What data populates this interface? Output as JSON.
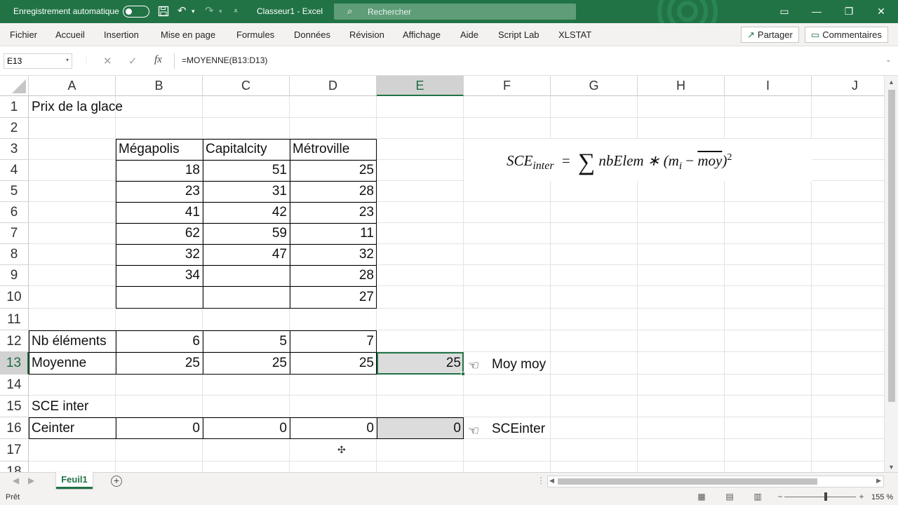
{
  "titlebar": {
    "autosave_label": "Enregistrement automatique",
    "doc_title": "Classeur1  -  Excel",
    "search_placeholder": "Rechercher",
    "accent": "#217346"
  },
  "ribbon": {
    "tabs": [
      "Fichier",
      "Accueil",
      "Insertion",
      "Mise en page",
      "Formules",
      "Données",
      "Révision",
      "Affichage",
      "Aide",
      "Script Lab",
      "XLSTAT"
    ],
    "share_label": "Partager",
    "comments_label": "Commentaires"
  },
  "formula_bar": {
    "name_box": "E13",
    "formula": "=MOYENNE(B13:D13)"
  },
  "columns": [
    "A",
    "B",
    "C",
    "D",
    "E",
    "F",
    "G",
    "H",
    "I",
    "J"
  ],
  "selected_column": "E",
  "rows": [
    "1",
    "2",
    "3",
    "4",
    "5",
    "6",
    "7",
    "8",
    "9",
    "10",
    "11",
    "12",
    "13",
    "14",
    "15",
    "16",
    "17",
    "18"
  ],
  "selected_row": "13",
  "cells": {
    "A1": "Prix de la glace",
    "B3": "Mégapolis",
    "C3": "Capitalcity",
    "D3": "Métroville",
    "B4": "18",
    "C4": "51",
    "D4": "25",
    "B5": "23",
    "C5": "31",
    "D5": "28",
    "B6": "41",
    "C6": "42",
    "D6": "23",
    "B7": "62",
    "C7": "59",
    "D7": "11",
    "B8": "32",
    "C8": "47",
    "D8": "32",
    "B9": "34",
    "D9": "28",
    "D10": "27",
    "A12": "Nb éléments",
    "B12": "6",
    "C12": "5",
    "D12": "7",
    "A13": "Moyenne",
    "B13": "25",
    "C13": "25",
    "D13": "25",
    "E13": "25",
    "A15": "SCE inter",
    "A16": "Ceinter",
    "B16": "0",
    "C16": "0",
    "D16": "0",
    "E16": "0"
  },
  "annotations": {
    "moy_label": "Moy moy",
    "sce_label": "SCEinter"
  },
  "equation": {
    "lhs": "SCE",
    "lhs_sub": "inter",
    "eq": "=",
    "sum": "∑",
    "term": "nbElem ∗ (m",
    "term_sub": "i",
    "minus": " − ",
    "bar": "moy",
    "close": ")",
    "exp": "2"
  },
  "sheet": {
    "tab": "Feuil1",
    "status": "Prêt",
    "zoom": "155 %"
  }
}
